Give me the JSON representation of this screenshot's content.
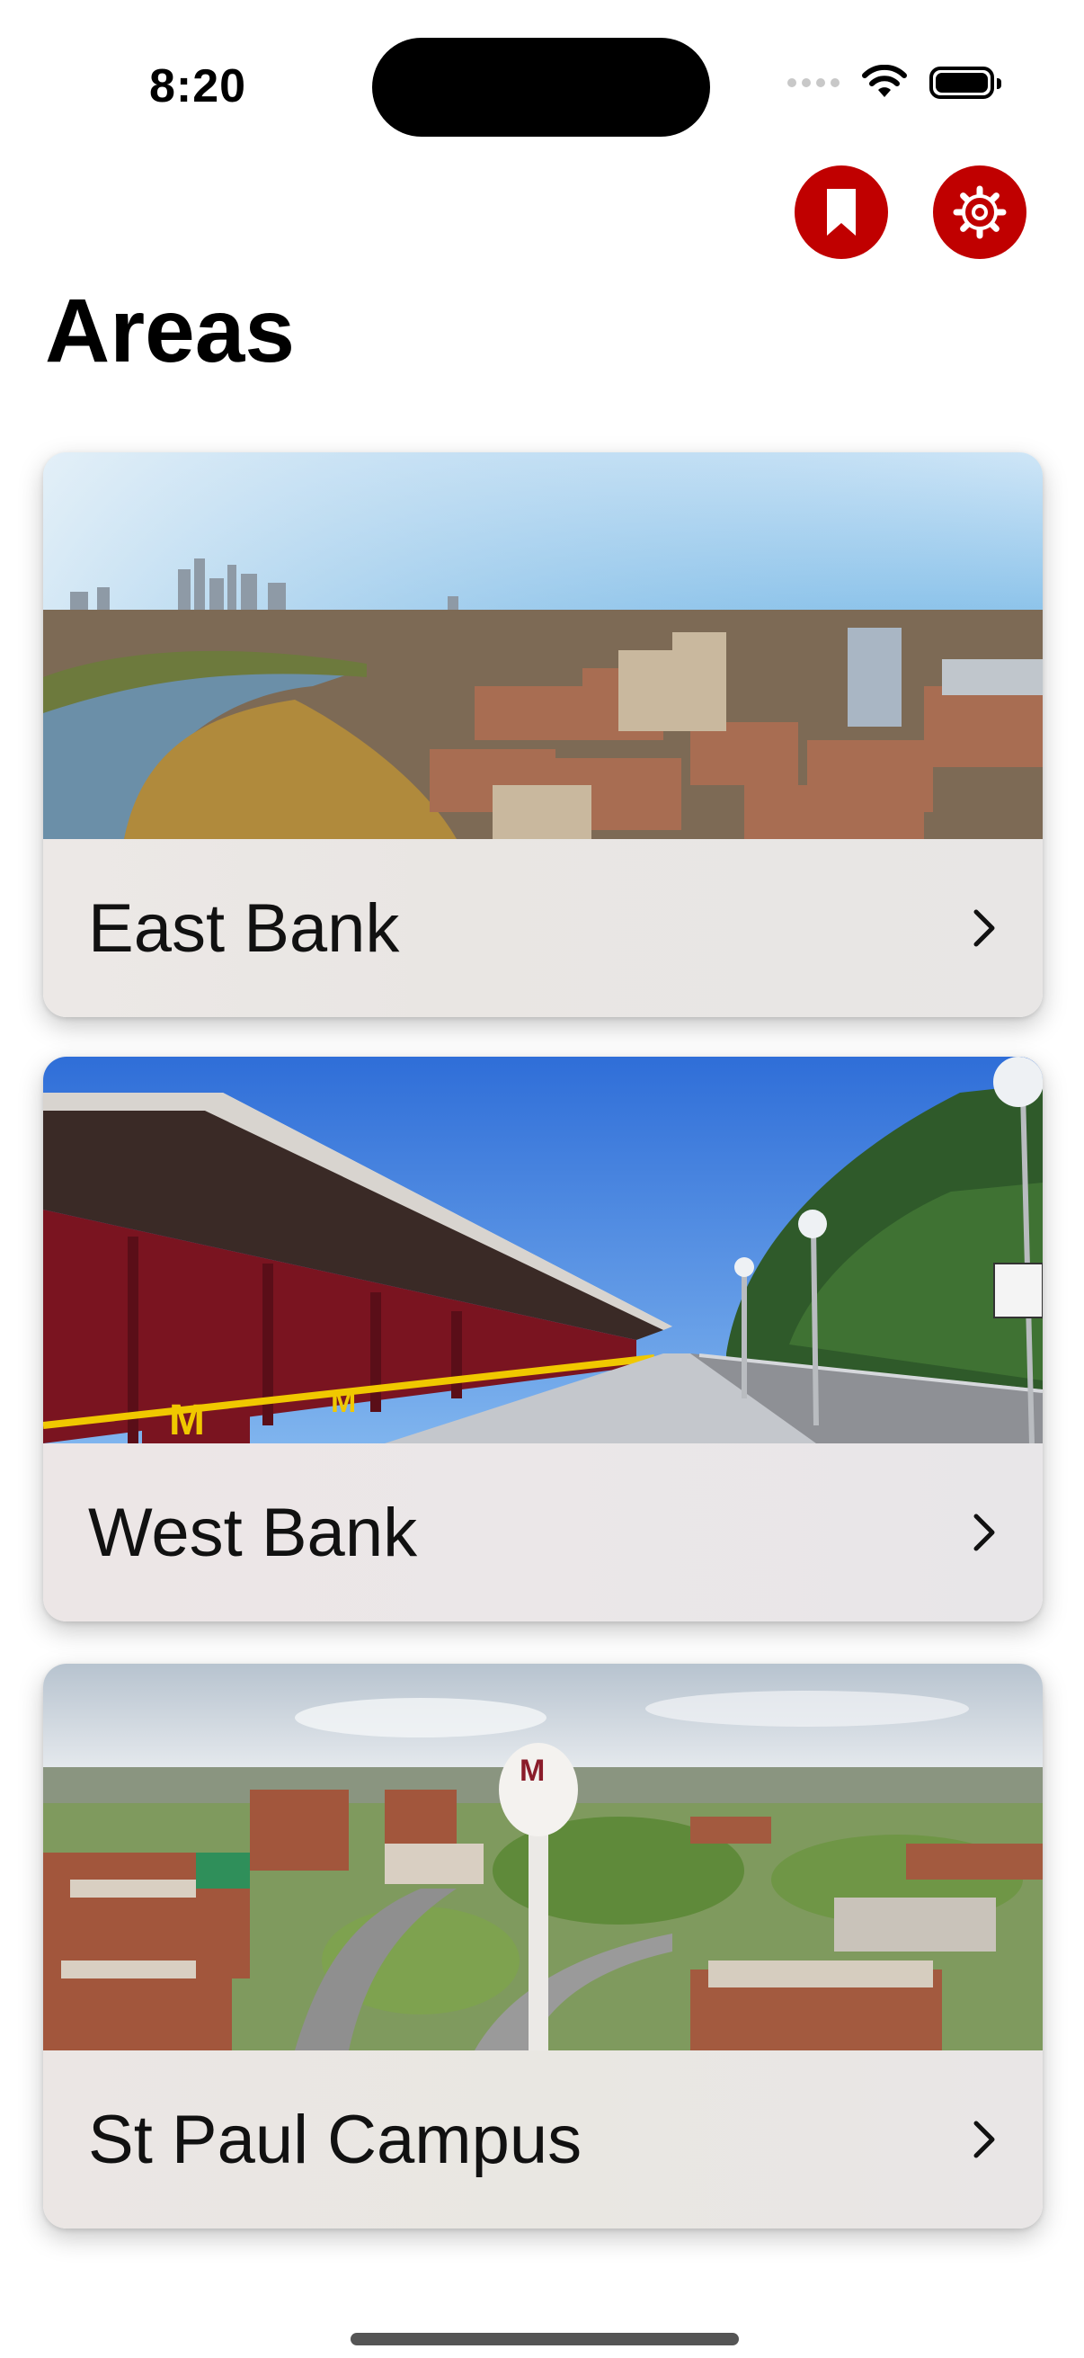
{
  "status_bar": {
    "time": "8:20"
  },
  "header": {
    "title": "Areas",
    "bookmark_icon": "bookmark-icon",
    "settings_icon": "gear-icon",
    "accent_color": "#c00000"
  },
  "areas": [
    {
      "label": "East Bank",
      "image": "aerial city skyline with river"
    },
    {
      "label": "West Bank",
      "image": "covered pedestrian bridge walkway"
    },
    {
      "label": "St Paul Campus",
      "image": "aerial campus view with water tower"
    }
  ]
}
